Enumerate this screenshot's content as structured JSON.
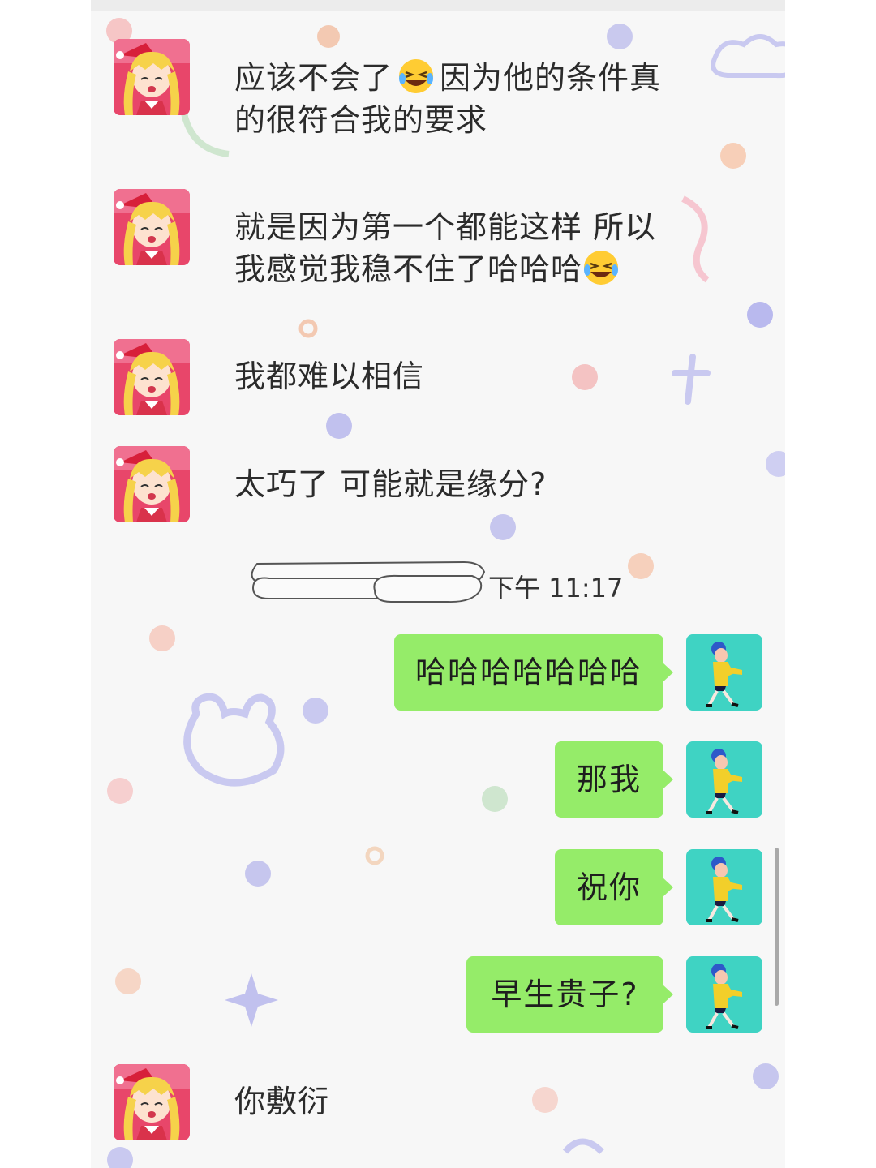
{
  "timestamp": "下午 11:17",
  "colors": {
    "chat_background": "#f7f7f7",
    "outgoing_bubble": "#95ec69",
    "text": "#2b2b2b"
  },
  "messages": [
    {
      "direction": "incoming",
      "avatar": "sailor-moon-avatar",
      "parts": [
        "应该不会了",
        "laughing-crying-emoji",
        "因为他的条件真\n的很符合我的要求"
      ]
    },
    {
      "direction": "incoming",
      "avatar": "sailor-moon-avatar",
      "parts": [
        "就是因为第一个都能这样 所以\n我感觉我稳不住了哈哈哈",
        "laughing-crying-emoji"
      ]
    },
    {
      "direction": "incoming",
      "avatar": "sailor-moon-avatar",
      "text": "我都难以相信"
    },
    {
      "direction": "incoming",
      "avatar": "sailor-moon-avatar",
      "text": "太巧了 可能就是缘分?"
    },
    {
      "direction": "outgoing",
      "avatar": "walking-girl-avatar",
      "text": "哈哈哈哈哈哈哈"
    },
    {
      "direction": "outgoing",
      "avatar": "walking-girl-avatar",
      "text": "那我"
    },
    {
      "direction": "outgoing",
      "avatar": "walking-girl-avatar",
      "text": "祝你"
    },
    {
      "direction": "outgoing",
      "avatar": "walking-girl-avatar",
      "text": "早生贵子?"
    },
    {
      "direction": "incoming",
      "avatar": "sailor-moon-avatar",
      "text": "你敷衍"
    }
  ]
}
